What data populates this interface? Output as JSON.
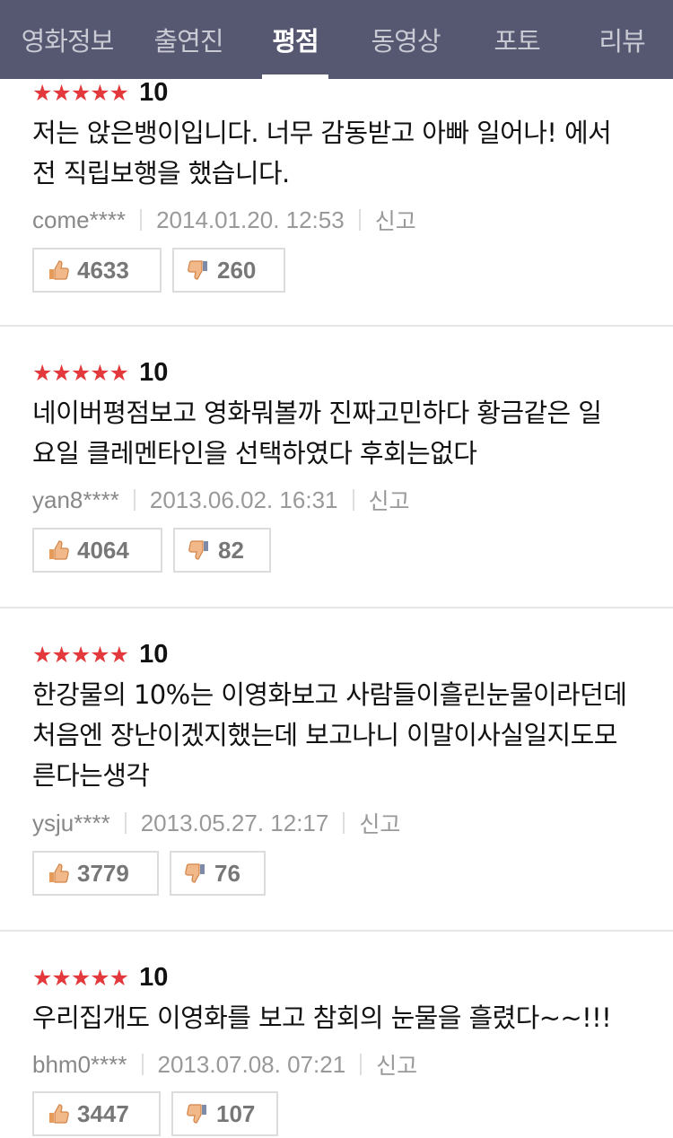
{
  "tabs": [
    {
      "label": "영화정보",
      "active": false
    },
    {
      "label": "출연진",
      "active": false
    },
    {
      "label": "평점",
      "active": true
    },
    {
      "label": "동영상",
      "active": false
    },
    {
      "label": "포토",
      "active": false
    },
    {
      "label": "리뷰",
      "active": false
    }
  ],
  "reviews": [
    {
      "stars": "★★★★★",
      "score": "10",
      "text_lines": [
        "저는 앉은뱅이입니다. 너무 감동받고 아빠 일어나! 에서",
        "전 직립보행을 했습니다."
      ],
      "user": "come****",
      "date": "2014.01.20. 12:53",
      "report": "신고",
      "likes": "4633",
      "dislikes": "260"
    },
    {
      "stars": "★★★★★",
      "score": "10",
      "text_lines": [
        "네이버평점보고 영화뭐볼까 진짜고민하다 황금같은 일",
        "요일 클레멘타인을 선택하였다 후회는없다"
      ],
      "user": "yan8****",
      "date": "2013.06.02. 16:31",
      "report": "신고",
      "likes": "4064",
      "dislikes": "82"
    },
    {
      "stars": "★★★★★",
      "score": "10",
      "text_lines": [
        "한강물의 10%는 이영화보고 사람들이흘린눈물이라던데",
        "처음엔 장난이겠지했는데 보고나니 이말이사실일지도모",
        "른다는생각"
      ],
      "user": "ysju****",
      "date": "2013.05.27. 12:17",
      "report": "신고",
      "likes": "3779",
      "dislikes": "76"
    },
    {
      "stars": "★★★★★",
      "score": "10",
      "text_lines": [
        "우리집개도 이영화를 보고 참회의 눈물을 흘렸다~~!!!"
      ],
      "user": "bhm0****",
      "date": "2013.07.08. 07:21",
      "report": "신고",
      "likes": "3447",
      "dislikes": "107"
    }
  ],
  "colors": {
    "header_bg": "#555870",
    "star": "#e3393c"
  }
}
